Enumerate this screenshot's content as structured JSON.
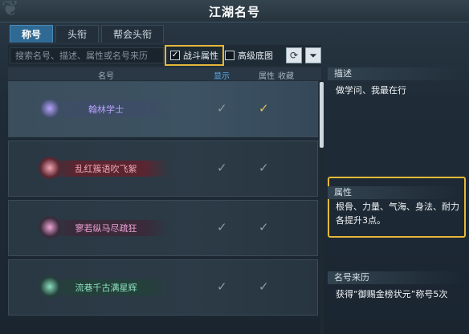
{
  "window": {
    "title": "江湖名号"
  },
  "tabs": [
    {
      "label": "称号",
      "active": true
    },
    {
      "label": "头衔",
      "active": false
    },
    {
      "label": "帮会头衔",
      "active": false
    }
  ],
  "filters": {
    "search_placeholder": "搜索名号、描述、属性或名号来历",
    "battle_attr": {
      "label": "战斗属性",
      "checked": true
    },
    "advanced_bg": {
      "label": "高级底图",
      "checked": false
    },
    "refresh_icon": "refresh-icon",
    "filter_icon": "filter-icon"
  },
  "columns": {
    "name": "名号",
    "display": "显示",
    "attr": "属性",
    "fav": "收藏"
  },
  "titles": [
    {
      "name": "翰林学士",
      "text_color": "#b9a2ff",
      "banner_bg": "#3d4d66",
      "display": true,
      "attr": true,
      "attr_gold": true,
      "selected": true
    },
    {
      "name": "乱红簇语吹飞絮",
      "text_color": "#f3a7b6",
      "banner_bg": "#5a2530",
      "display": true,
      "attr": true,
      "attr_gold": false,
      "selected": false
    },
    {
      "name": "寥若纵马尽疏狂",
      "text_color": "#f0a7d8",
      "banner_bg": "#3a2a3a",
      "display": true,
      "attr": true,
      "attr_gold": false,
      "selected": false
    },
    {
      "name": "流巷千古满星辉",
      "text_color": "#8de0c0",
      "banner_bg": "#24403a",
      "display": true,
      "attr": true,
      "attr_gold": false,
      "selected": false
    }
  ],
  "detail": {
    "desc_label": "描述",
    "desc_text": "做学问、我最在行",
    "attr_label": "属性",
    "attr_text": "根骨、力量、气海、身法、耐力各提升3点。",
    "origin_label": "名号来历",
    "origin_text": "获得“御赐金榜状元”称号5次"
  },
  "colors": {
    "accent_tab": "#2f6a94",
    "highlight": "#e5b83a"
  }
}
